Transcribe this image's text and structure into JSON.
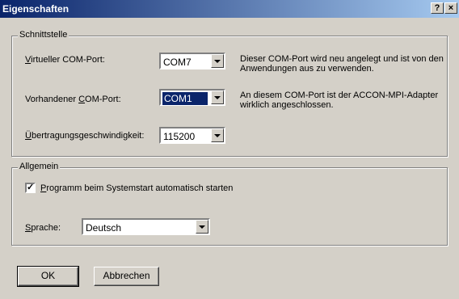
{
  "window": {
    "title": "Eigenschaften",
    "help_label": "?",
    "close_label": "×"
  },
  "interface": {
    "legend": "Schnittstelle",
    "virtual_port": {
      "label_accel": "V",
      "label_rest": "irtueller COM-Port:",
      "value": "COM7",
      "description": "Dieser COM-Port wird neu angelegt und ist von den Anwendungen aus zu verwenden."
    },
    "existing_port": {
      "label_pre": "Vorhandener ",
      "label_accel": "C",
      "label_rest": "OM-Port:",
      "value": "COM1",
      "description": "An diesem COM-Port ist der ACCON-MPI-Adapter wirklich angeschlossen."
    },
    "baud_rate": {
      "label_accel": "Ü",
      "label_rest": "bertragungsgeschwindigkeit:",
      "value": "115200"
    }
  },
  "general": {
    "legend": "Allgemein",
    "autostart": {
      "checked": true,
      "check_glyph": "✓",
      "label_accel": "P",
      "label_rest": "rogramm beim Systemstart automatisch starten"
    },
    "language": {
      "label_accel": "S",
      "label_rest": "prache:",
      "value": "Deutsch"
    }
  },
  "buttons": {
    "ok": "OK",
    "cancel": "Abbrechen"
  }
}
